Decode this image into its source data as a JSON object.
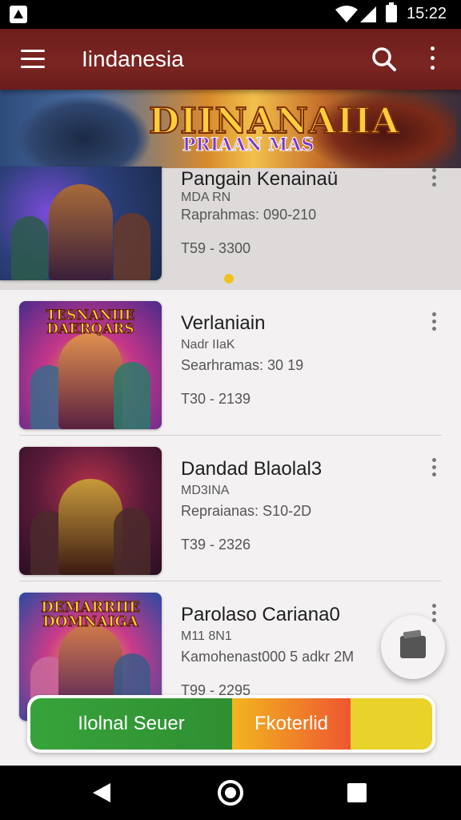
{
  "status_bar": {
    "time": "15:22"
  },
  "app_bar": {
    "title": "Iindanesia"
  },
  "banner": {
    "logo_title": "DIINANAIIA",
    "logo_subtitle": "PRIAAN MAS"
  },
  "games": [
    {
      "name": "Pangain Kenainaü",
      "sub": "MDA RN",
      "line2": "Raprahmas: 090-210",
      "price": "T59 - 3300",
      "thumb_title": ""
    },
    {
      "name": "Verlaniain",
      "sub": "Nadr IIaK",
      "line2": "Searhramas: 30 19",
      "price": "T30 - 2139",
      "thumb_title": "TESNANIIE DAERQARS"
    },
    {
      "name": "Dandad Blaolal3",
      "sub": "MD3INA",
      "line2": "Repraianas: S10-2D",
      "price": "T39 - 2326",
      "thumb_title": ""
    },
    {
      "name": "Parolaso Cariana0",
      "sub": "M11 8N1",
      "line2": "Kamohenast000 5 adkr 2M",
      "price": "T99 - 2295",
      "thumb_title": "DEMARRIIE DOMNAIGA"
    }
  ],
  "cta": {
    "left_label": "Ilolnal Seuer",
    "right_label": "Fkoterlid"
  },
  "icons": [
    "menu-icon",
    "search-icon",
    "more-vert-icon",
    "wallet-icon",
    "back-icon",
    "home-icon",
    "recents-icon",
    "wifi-icon",
    "signal-icon",
    "battery-icon"
  ],
  "colors": {
    "app_bar": "#7b2522",
    "cta_green": "#37a33a",
    "cta_yellow": "#e9d22a",
    "cta_orange": "#ee5630"
  }
}
